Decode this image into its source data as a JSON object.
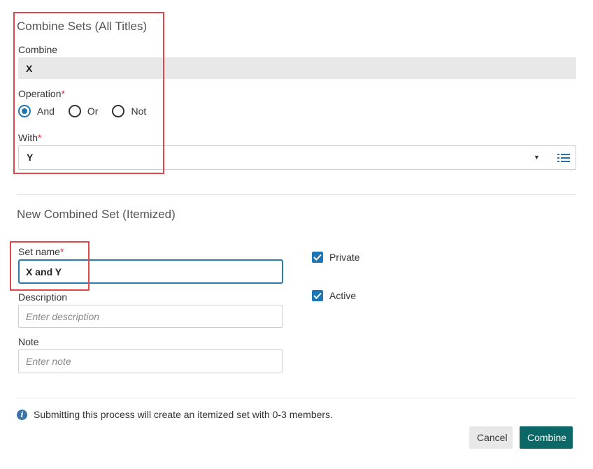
{
  "combine_section": {
    "title": "Combine Sets (All Titles)",
    "combine_label": "Combine",
    "combine_value": "X",
    "operation_label": "Operation",
    "required_mark": "*",
    "operations": [
      {
        "label": "And",
        "selected": true
      },
      {
        "label": "Or",
        "selected": false
      },
      {
        "label": "Not",
        "selected": false
      }
    ],
    "with_label": "With",
    "with_value": "Y",
    "caret": "▼"
  },
  "new_set_section": {
    "title": "New Combined Set (Itemized)",
    "set_name_label": "Set name",
    "set_name_value": "X and Y",
    "description_label": "Description",
    "description_placeholder": "Enter description",
    "note_label": "Note",
    "note_placeholder": "Enter note",
    "private_label": "Private",
    "private_checked": true,
    "active_label": "Active",
    "active_checked": true
  },
  "info": {
    "icon": "info-icon",
    "text": "Submitting this process will create an itemized set with 0-3 members."
  },
  "buttons": {
    "cancel": "Cancel",
    "combine": "Combine"
  },
  "colors": {
    "accent": "#1f76b5",
    "primary_button": "#0b6866",
    "highlight_box": "#e0474c",
    "required": "#e0262b"
  }
}
